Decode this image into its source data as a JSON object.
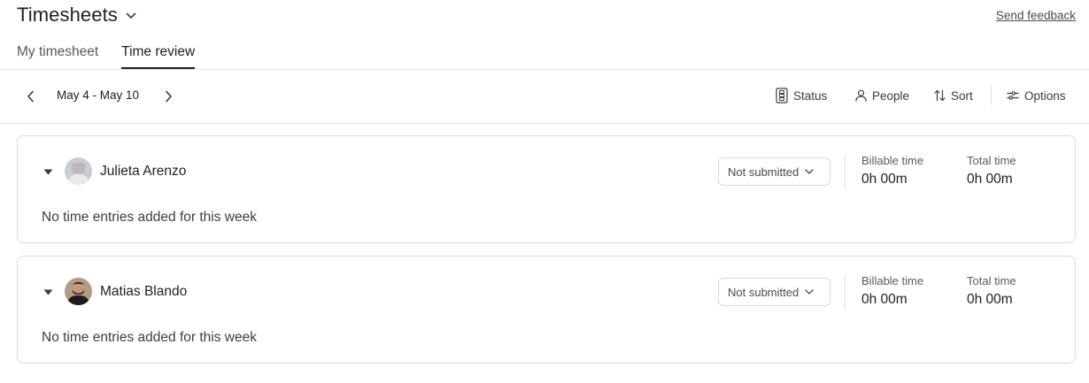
{
  "app": {
    "title": "Timesheets",
    "feedback_link": "Send feedback"
  },
  "tabs": [
    {
      "label": "My timesheet",
      "active": false
    },
    {
      "label": "Time review",
      "active": true
    }
  ],
  "toolbar": {
    "date_range": "May 4 - May 10",
    "status_label": "Status",
    "people_label": "People",
    "sort_label": "Sort",
    "options_label": "Options"
  },
  "people": [
    {
      "name": "Julieta Arenzo",
      "status": "Not submitted",
      "billable_label": "Billable time",
      "billable_value": "0h 00m",
      "total_label": "Total time",
      "total_value": "0h 00m",
      "empty_message": "No time entries added for this week"
    },
    {
      "name": "Matias Blando",
      "status": "Not submitted",
      "billable_label": "Billable time",
      "billable_value": "0h 00m",
      "total_label": "Total time",
      "total_value": "0h 00m",
      "empty_message": "No time entries added for this week"
    }
  ],
  "colors": {
    "text": "#1e1f21",
    "border": "#dcdcdc",
    "muted": "#5a5b5e"
  }
}
